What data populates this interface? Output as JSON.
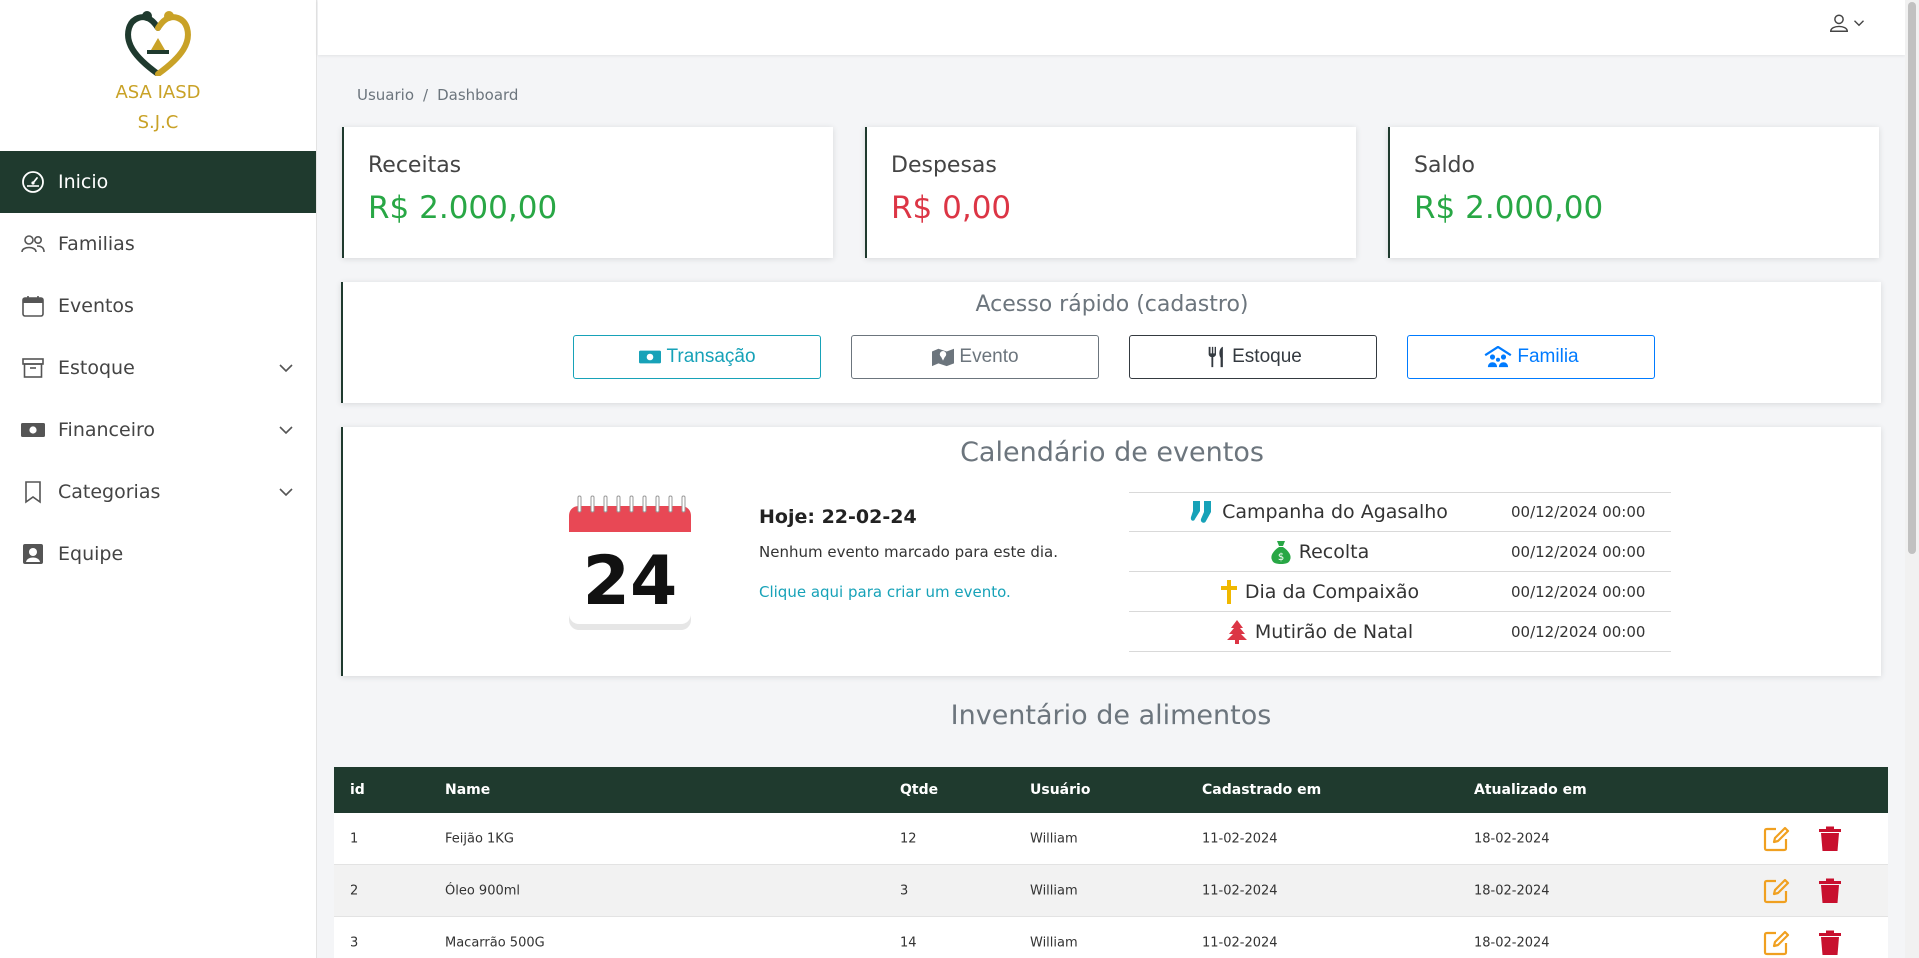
{
  "brand": {
    "line1": "ASA IASD",
    "line2": "S.J.C"
  },
  "sidebar": {
    "items": [
      {
        "label": "Inicio",
        "icon": "dashboard-icon",
        "active": true
      },
      {
        "label": "Familias",
        "icon": "users-icon"
      },
      {
        "label": "Eventos",
        "icon": "calendar-icon"
      },
      {
        "label": "Estoque",
        "icon": "archive-icon",
        "expandable": true
      },
      {
        "label": "Financeiro",
        "icon": "cash-icon",
        "expandable": true
      },
      {
        "label": "Categorias",
        "icon": "bookmark-icon",
        "expandable": true
      },
      {
        "label": "Equipe",
        "icon": "person-badge-icon"
      }
    ]
  },
  "breadcrumb": {
    "first": "Usuario",
    "separator": "/",
    "current": "Dashboard"
  },
  "stats": [
    {
      "title": "Receitas",
      "value": "R$ 2.000,00",
      "color": "#28a745"
    },
    {
      "title": "Despesas",
      "value": "R$ 0,00",
      "color": "#dc3545"
    },
    {
      "title": "Saldo",
      "value": "R$ 2.000,00",
      "color": "#28a745"
    }
  ],
  "quick_access": {
    "title": "Acesso rápido (cadastro)",
    "buttons": [
      {
        "label": "Transação",
        "icon": "cash-icon",
        "color": "#17a2b8"
      },
      {
        "label": "Evento",
        "icon": "map-icon",
        "color": "#6c757d"
      },
      {
        "label": "Estoque",
        "icon": "utensils-icon",
        "color": "#343a40"
      },
      {
        "label": "Familia",
        "icon": "family-house-icon",
        "color": "#007bff"
      }
    ]
  },
  "calendar": {
    "title": "Calendário de eventos",
    "day": "24",
    "today": "Hoje: 22-02-24",
    "no_events": "Nenhum evento marcado para este dia.",
    "create_link": "Clique aqui para criar um evento.",
    "events": [
      {
        "name": "Campanha do Agasalho",
        "date": "00/12/2024 00:00",
        "icon": "socks-icon",
        "icon_color": "#17a2b8"
      },
      {
        "name": "Recolta",
        "date": "00/12/2024 00:00",
        "icon": "money-bag-icon",
        "icon_color": "#28a745"
      },
      {
        "name": "Dia da Compaixão",
        "date": "00/12/2024 00:00",
        "icon": "cross-icon",
        "icon_color": "#f0b800"
      },
      {
        "name": "Mutirão de Natal",
        "date": "00/12/2024 00:00",
        "icon": "tree-icon",
        "icon_color": "#dc3545"
      }
    ]
  },
  "inventory": {
    "title": "Inventário de alimentos",
    "columns": [
      "id",
      "Name",
      "Qtde",
      "Usuário",
      "Cadastrado em",
      "Atualizado em"
    ],
    "rows": [
      {
        "id": "1",
        "name": "Feijão 1KG",
        "qtd": "12",
        "user": "William",
        "created": "11-02-2024",
        "updated": "18-02-2024"
      },
      {
        "id": "2",
        "name": "Óleo 900ml",
        "qtd": "3",
        "user": "William",
        "created": "11-02-2024",
        "updated": "18-02-2024"
      },
      {
        "id": "3",
        "name": "Macarrão 500G",
        "qtd": "14",
        "user": "William",
        "created": "11-02-2024",
        "updated": "18-02-2024"
      }
    ]
  },
  "colors": {
    "sidebar_active": "#1f3a2e",
    "brand_gold": "#c9a227",
    "edit": "#f0a020",
    "delete": "#c8102e"
  }
}
